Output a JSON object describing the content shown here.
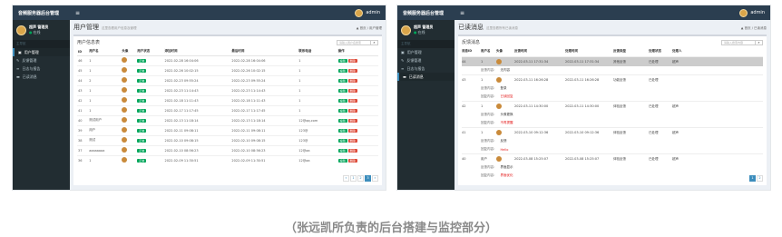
{
  "app": {
    "brand": "音频服务器后台管理",
    "user_name": "超声 管理员",
    "user_status": "在线",
    "top_user": "admin",
    "nav_header": "主导航",
    "nav_items": [
      "用户管理",
      "反馈管理",
      "日志与报告",
      "已读消息"
    ]
  },
  "left": {
    "page_title": "用户管理",
    "page_sub": "这里查看用户信息及管理",
    "crumb": "▲ 首页 / 用户管理",
    "box_title": "用户信息表",
    "search_placeholder": "请输入用户名搜索",
    "columns": [
      "ID",
      "用户名",
      "头像",
      "用户状态",
      "添加时间",
      "最后时间",
      "联系电话",
      "操作"
    ],
    "rows": [
      {
        "id": "46",
        "name": "1",
        "status": "正常",
        "added": "2022-02-28 16:04:06",
        "last": "2022-02-28 16:04:06",
        "phone": "1"
      },
      {
        "id": "45",
        "name": "1",
        "status": "正常",
        "added": "2022-02-26 10:02:15",
        "last": "2022-02-26 10:02:15",
        "phone": "1"
      },
      {
        "id": "44",
        "name": "2",
        "status": "正常",
        "added": "2022-02-23 09:55:24",
        "last": "2022-02-23 09:55:24",
        "phone": "1"
      },
      {
        "id": "43",
        "name": "1",
        "status": "正常",
        "added": "2022-02-23 11:14:43",
        "last": "2022-02-23 11:14:43",
        "phone": "1"
      },
      {
        "id": "42",
        "name": "1",
        "status": "正常",
        "added": "2022-02-18 11:11:43",
        "last": "2022-02-18 11:11:43",
        "phone": "1"
      },
      {
        "id": "41",
        "name": "1",
        "status": "正常",
        "added": "2022-02-17 11:17:45",
        "last": "2022-02-17 11:17:45",
        "phone": "1"
      },
      {
        "id": "40",
        "name": "测试用户",
        "status": "正常",
        "added": "2022-02-13 11:18:14",
        "last": "2022-02-13 11:18:14",
        "phone": "12@qq.com"
      },
      {
        "id": "39",
        "name": "用户",
        "status": "正常",
        "added": "2022-02-11 09:08:11",
        "last": "2022-02-11 09:08:11",
        "phone": "123@"
      },
      {
        "id": "38",
        "name": "测试",
        "status": "正常",
        "added": "2022-02-10 09:08:15",
        "last": "2022-02-10 09:08:15",
        "phone": "123@"
      },
      {
        "id": "37",
        "name": "aaaaaaaa",
        "status": "正常",
        "added": "2022-02-10 08:56:23",
        "last": "2022-02-10 08:56:23",
        "phone": "12@aa"
      },
      {
        "id": "36",
        "name": "1",
        "status": "正常",
        "added": "2022-02-09 11:30:51",
        "last": "2022-02-09 11:30:51",
        "phone": "12@aa"
      }
    ],
    "edit_label": "编辑",
    "delete_label": "删除",
    "pager": [
      "«",
      "1",
      "2",
      "3",
      "»"
    ]
  },
  "right": {
    "page_title": "已读消息",
    "page_sub": "这里查看所有已读消息",
    "crumb": "▲ 首页 / 已读消息",
    "box_title": "反馈消息",
    "search_placeholder": "请输入搜索内容",
    "columns": [
      "消息ID",
      "用户名",
      "头像",
      "反馈时间",
      "处理时间",
      "反馈类型",
      "处理状态",
      "处理人"
    ],
    "feedback_label": "反馈内容：",
    "reply_label": "回复内容：",
    "items": [
      {
        "id": "44",
        "user": "1",
        "time1": "2022-03-11 17:31:34",
        "time2": "2022-03-11 17:31:34",
        "type": "其他反馈",
        "status": "已处理",
        "handler": "超声",
        "content": "无内容",
        "reply": "",
        "highlight": true
      },
      {
        "id": "43",
        "user": "1",
        "time1": "2022-03-11 16:26:28",
        "time2": "2022-03-11 16:26:28",
        "type": "功能反馈",
        "status": "已处理",
        "handler": "",
        "content": "登录",
        "reply": "已读回复",
        "highlight": false
      },
      {
        "id": "42",
        "user": "1",
        "time1": "2022-03-11 14:30:00",
        "time2": "2022-03-11 14:30:00",
        "type": "体验反馈",
        "status": "已处理",
        "handler": "超声",
        "content": "头像更换",
        "reply": "不再提醒",
        "highlight": false
      },
      {
        "id": "41",
        "user": "1",
        "time1": "2022-03-10 09:12:36",
        "time2": "2022-03-10 09:12:36",
        "type": "体验反馈",
        "status": "已处理",
        "handler": "超声",
        "content": "反馈",
        "reply": "Hello",
        "highlight": false
      },
      {
        "id": "40",
        "user": "用户",
        "time1": "2022-03-08 15:25:07",
        "time2": "2022-03-08 15:25:07",
        "type": "体验反馈",
        "status": "已处理",
        "handler": "超声",
        "content": "界面显示",
        "reply": "界面优化",
        "highlight": false
      }
    ],
    "pager": [
      "1",
      "2"
    ]
  },
  "caption": "（张远凯所负责的后台搭建与监控部分）"
}
